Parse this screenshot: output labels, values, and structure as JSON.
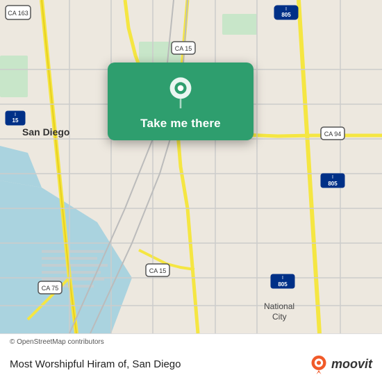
{
  "map": {
    "alt": "Map of San Diego area"
  },
  "popup": {
    "button_label": "Take me there",
    "pin_icon": "location-pin"
  },
  "bottom_bar": {
    "copyright": "© OpenStreetMap contributors",
    "location_label": "Most Worshipful Hiram of, San Diego",
    "moovit_label": "moovit"
  }
}
